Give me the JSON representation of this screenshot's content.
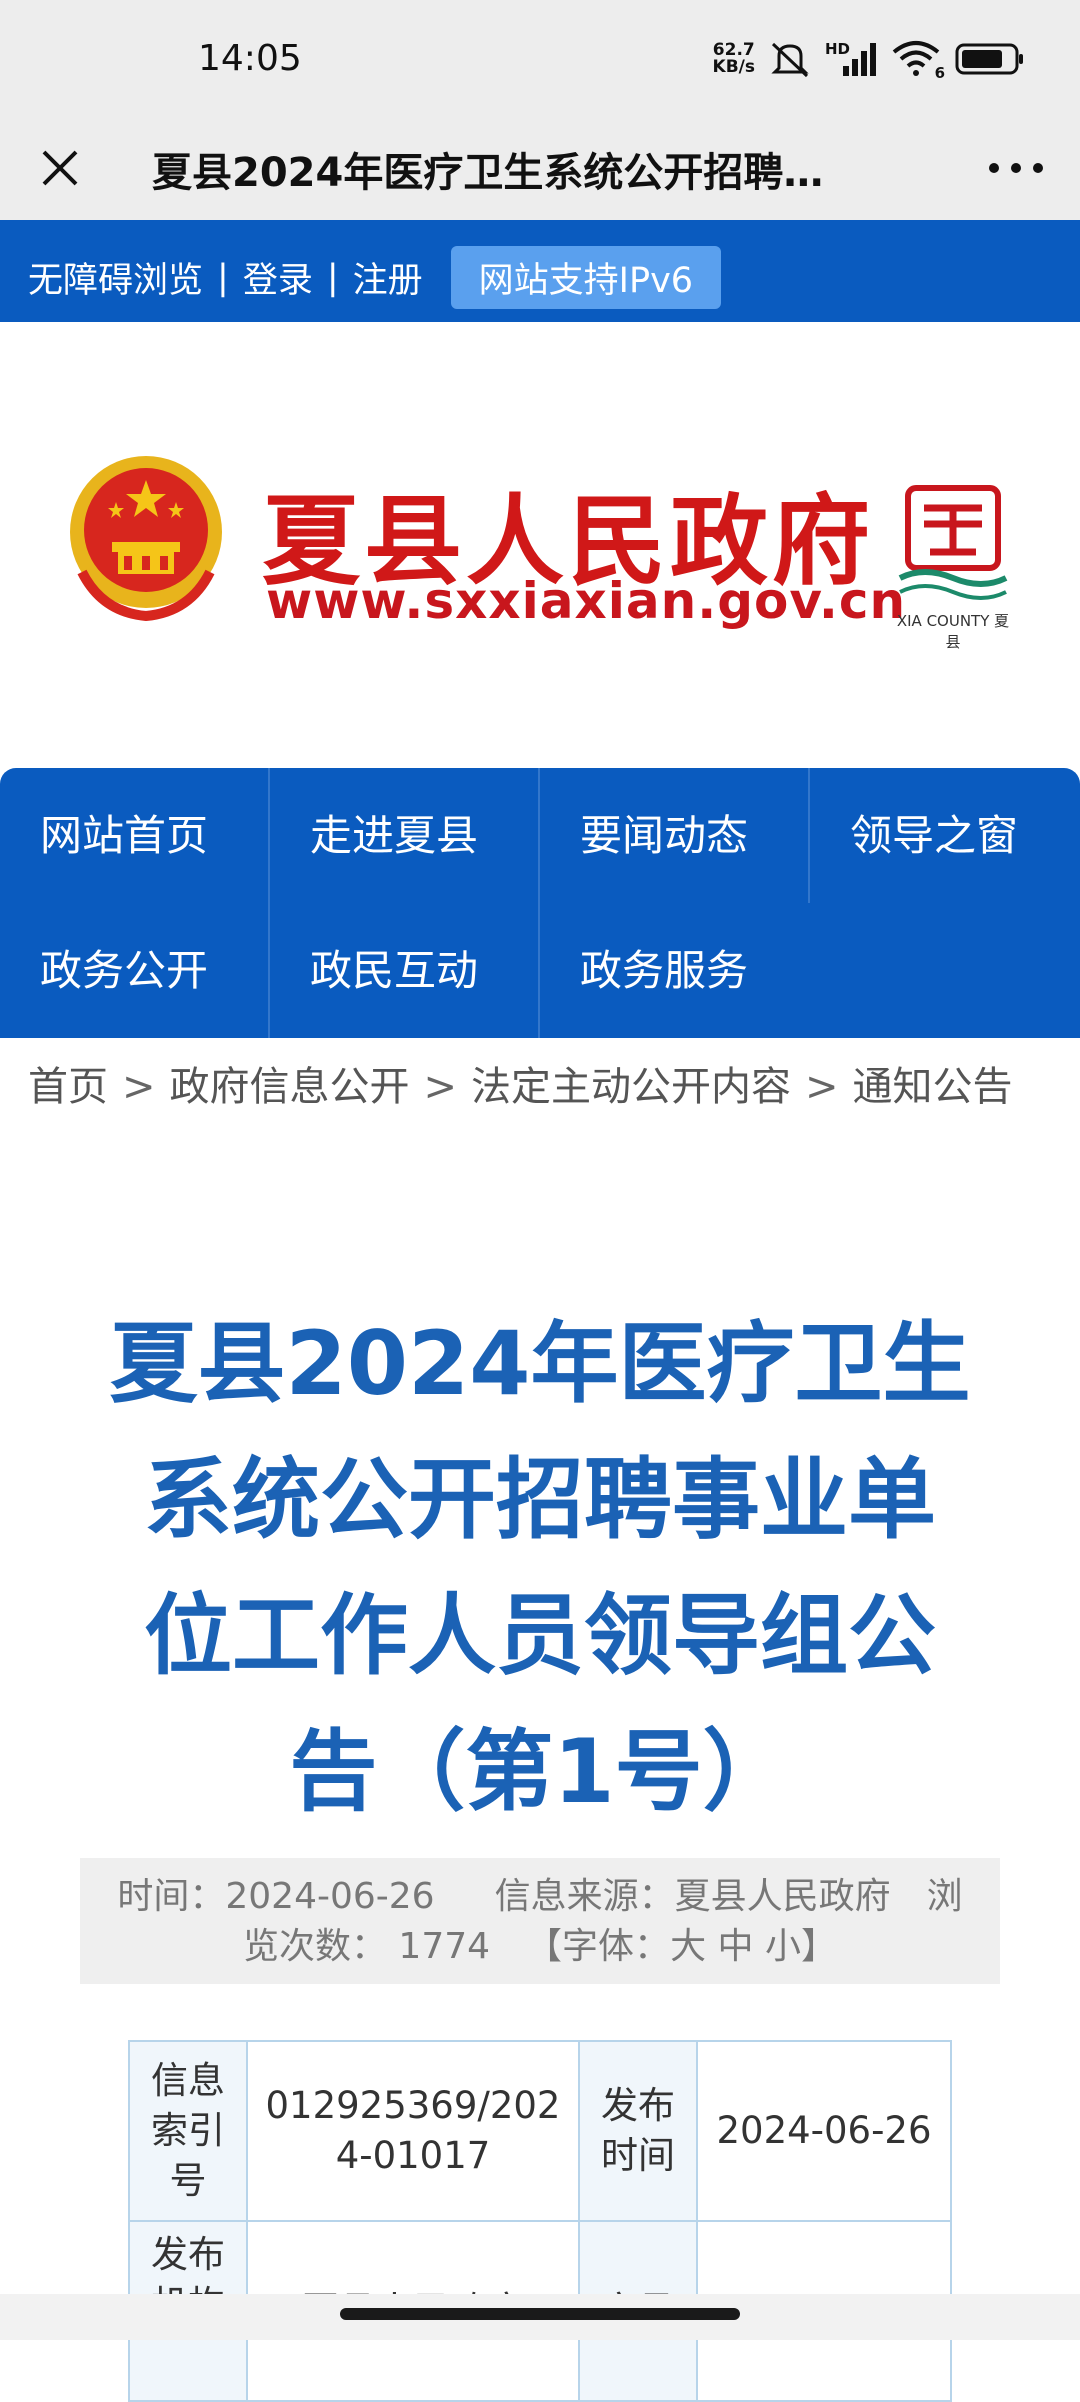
{
  "status": {
    "time": "14:05",
    "net_speed_value": "62.7",
    "net_speed_unit": "KB/s",
    "hd_label": "HD",
    "wifi_label": "6",
    "icons": [
      "mute-icon",
      "signal-icon",
      "wifi-icon",
      "battery-icon"
    ]
  },
  "titlebar": {
    "title": "夏县2024年医疗卫生系统公开招聘…",
    "close_icon": "close-icon",
    "more_icon": "more-icon"
  },
  "topbar": {
    "accessibility": "无障碍浏览",
    "sep1": "|",
    "login": "登录",
    "sep2": "|",
    "register": "注册",
    "ipv6": "网站支持IPv6"
  },
  "header": {
    "site_name": "夏县人民政府",
    "site_url": "www.sxxiaxian.gov.cn",
    "county_logo_text": "XIA COUNTY 夏县"
  },
  "nav": {
    "items": [
      {
        "label": "网站首页"
      },
      {
        "label": "走进夏县"
      },
      {
        "label": "要闻动态"
      },
      {
        "label": "领导之窗"
      },
      {
        "label": "政务公开"
      },
      {
        "label": "政民互动"
      },
      {
        "label": "政务服务"
      }
    ]
  },
  "breadcrumb": {
    "sep": ">",
    "items": [
      "首页",
      "政府信息公开",
      "法定主动公开内容",
      "通知公告"
    ]
  },
  "article": {
    "title_lines": [
      "夏县2024年医疗卫生",
      "系统公开招聘事业单",
      "位工作人员领导组公",
      "告（第1号）"
    ]
  },
  "meta": {
    "time_label": "时间：",
    "time_value": "2024-06-26",
    "source_label": "信息来源：",
    "source_value": "夏县人民政府",
    "views_label_part1": "浏",
    "views_label_part2": "览次数：",
    "views_value": "1774",
    "font_open": "【字体：",
    "font_large": "大",
    "font_medium": "中",
    "font_small": "小",
    "font_close": "】"
  },
  "info_table": {
    "rows": [
      {
        "label1": "信息索引号",
        "value1": "012925369/2024-01017",
        "label2": "发布时间",
        "value2": "2024-06-26"
      },
      {
        "label1": "发布机构",
        "value1": "夏县人民政府",
        "label2": "文号",
        "value2": ""
      }
    ]
  },
  "colors": {
    "brand_blue": "#0a5bbf",
    "title_blue": "#1b62b5",
    "site_red": "#d01818"
  }
}
